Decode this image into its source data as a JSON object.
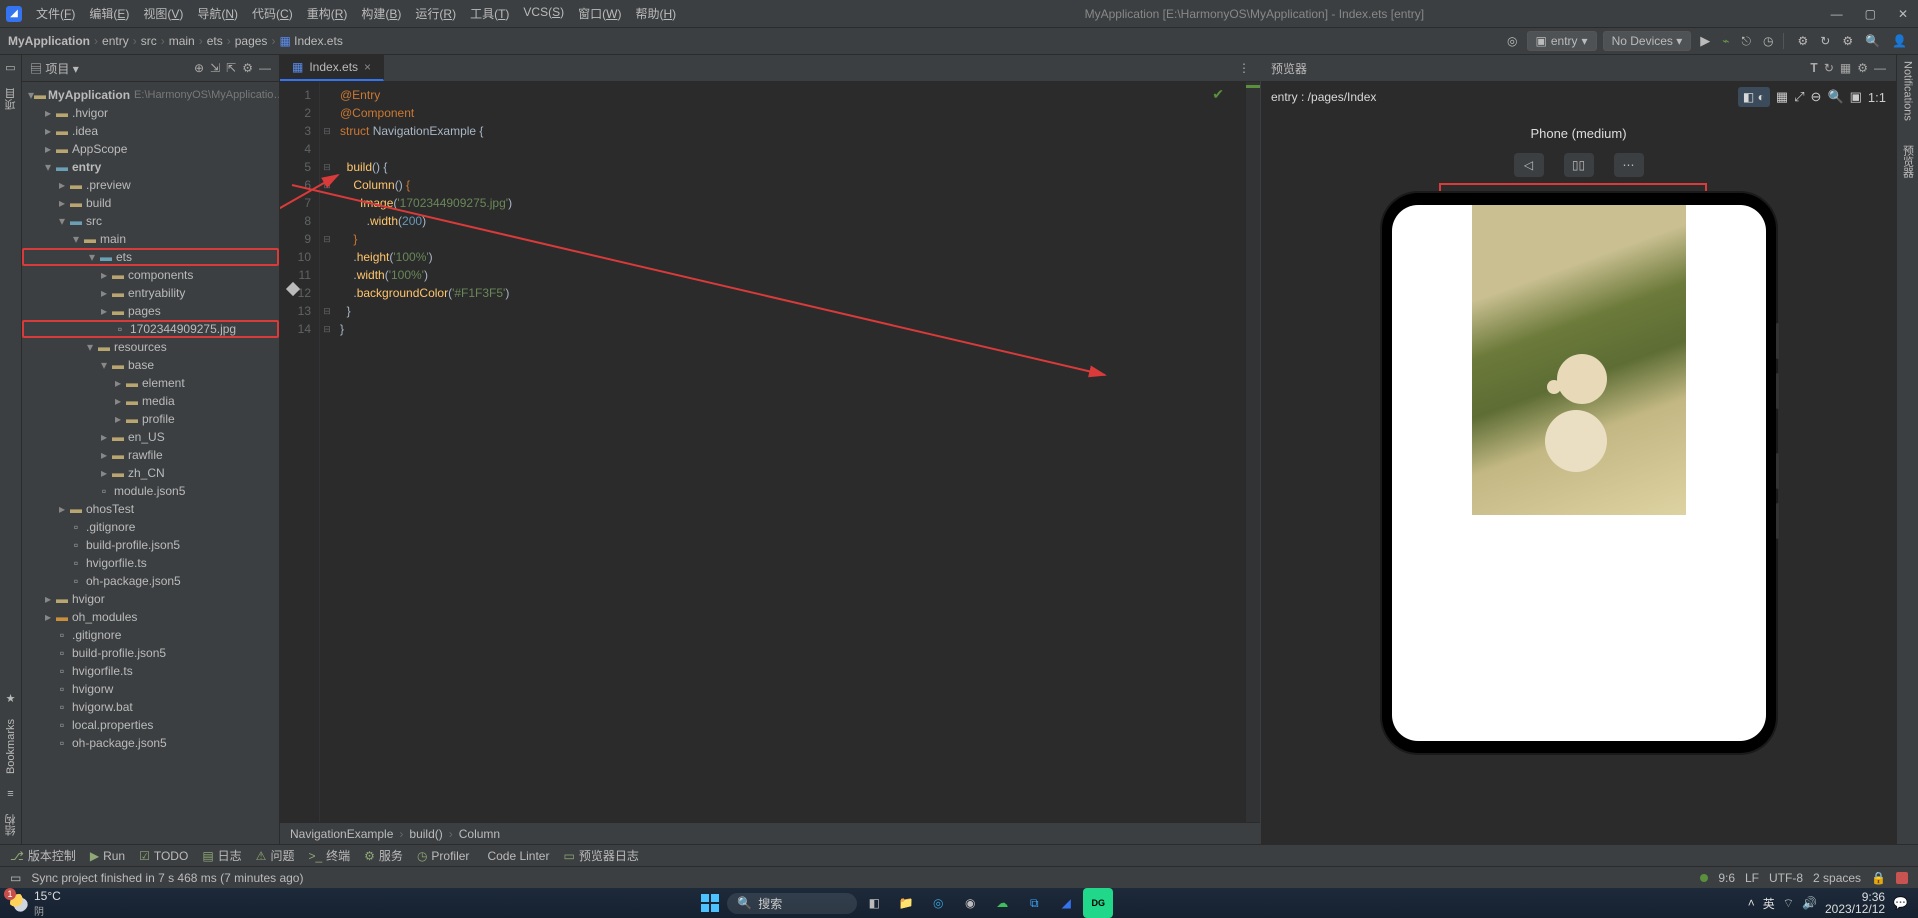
{
  "titlebar": {
    "menus": [
      "文件(F)",
      "编辑(E)",
      "视图(V)",
      "导航(N)",
      "代码(C)",
      "重构(R)",
      "构建(B)",
      "运行(R)",
      "工具(T)",
      "VCS(S)",
      "窗口(W)",
      "帮助(H)"
    ],
    "title": "MyApplication [E:\\HarmonyOS\\MyApplication] - Index.ets [entry]"
  },
  "navbar": {
    "crumbs": [
      "MyApplication",
      "entry",
      "src",
      "main",
      "ets",
      "pages",
      "Index.ets"
    ],
    "entry_pill": "entry",
    "device_pill": "No Devices ▾"
  },
  "project": {
    "title": "项目",
    "rows": [
      {
        "d": 0,
        "arrow": "▾",
        "icon": "folder-ico",
        "label": "MyApplication",
        "extra": "E:\\HarmonyOS\\MyApplicatio…",
        "bold": true
      },
      {
        "d": 1,
        "arrow": "▸",
        "icon": "folder-ico",
        "label": ".hvigor"
      },
      {
        "d": 1,
        "arrow": "▸",
        "icon": "folder-ico",
        "label": ".idea"
      },
      {
        "d": 1,
        "arrow": "▸",
        "icon": "folder-ico",
        "label": "AppScope"
      },
      {
        "d": 1,
        "arrow": "▾",
        "icon": "folder-blue",
        "label": "entry",
        "bold": true
      },
      {
        "d": 2,
        "arrow": "▸",
        "icon": "folder-ico",
        "label": ".preview"
      },
      {
        "d": 2,
        "arrow": "▸",
        "icon": "folder-ico",
        "label": "build"
      },
      {
        "d": 2,
        "arrow": "▾",
        "icon": "folder-blue",
        "label": "src"
      },
      {
        "d": 3,
        "arrow": "▾",
        "icon": "folder-ico",
        "label": "main"
      },
      {
        "d": 4,
        "arrow": "▾",
        "icon": "folder-blue",
        "label": "ets",
        "red": true
      },
      {
        "d": 5,
        "arrow": "▸",
        "icon": "folder-ico",
        "label": "components"
      },
      {
        "d": 5,
        "arrow": "▸",
        "icon": "folder-ico",
        "label": "entryability"
      },
      {
        "d": 5,
        "arrow": "▸",
        "icon": "folder-ico",
        "label": "pages"
      },
      {
        "d": 5,
        "arrow": " ",
        "icon": "file-ico",
        "label": "1702344909275.jpg",
        "red": true
      },
      {
        "d": 4,
        "arrow": "▾",
        "icon": "folder-ico",
        "label": "resources"
      },
      {
        "d": 5,
        "arrow": "▾",
        "icon": "folder-ico",
        "label": "base"
      },
      {
        "d": 6,
        "arrow": "▸",
        "icon": "folder-ico",
        "label": "element"
      },
      {
        "d": 6,
        "arrow": "▸",
        "icon": "folder-ico",
        "label": "media"
      },
      {
        "d": 6,
        "arrow": "▸",
        "icon": "folder-ico",
        "label": "profile"
      },
      {
        "d": 5,
        "arrow": "▸",
        "icon": "folder-ico",
        "label": "en_US"
      },
      {
        "d": 5,
        "arrow": "▸",
        "icon": "folder-ico",
        "label": "rawfile"
      },
      {
        "d": 5,
        "arrow": "▸",
        "icon": "folder-ico",
        "label": "zh_CN"
      },
      {
        "d": 4,
        "arrow": " ",
        "icon": "file-ico",
        "label": "module.json5"
      },
      {
        "d": 2,
        "arrow": "▸",
        "icon": "folder-ico",
        "label": "ohosTest"
      },
      {
        "d": 2,
        "arrow": " ",
        "icon": "file-ico",
        "label": ".gitignore"
      },
      {
        "d": 2,
        "arrow": " ",
        "icon": "file-ico",
        "label": "build-profile.json5"
      },
      {
        "d": 2,
        "arrow": " ",
        "icon": "file-ico",
        "label": "hvigorfile.ts"
      },
      {
        "d": 2,
        "arrow": " ",
        "icon": "file-ico",
        "label": "oh-package.json5"
      },
      {
        "d": 1,
        "arrow": "▸",
        "icon": "folder-ico",
        "label": "hvigor"
      },
      {
        "d": 1,
        "arrow": "▸",
        "icon": "folder-orange",
        "label": "oh_modules"
      },
      {
        "d": 1,
        "arrow": " ",
        "icon": "file-ico",
        "label": ".gitignore"
      },
      {
        "d": 1,
        "arrow": " ",
        "icon": "file-ico",
        "label": "build-profile.json5"
      },
      {
        "d": 1,
        "arrow": " ",
        "icon": "file-ico",
        "label": "hvigorfile.ts"
      },
      {
        "d": 1,
        "arrow": " ",
        "icon": "file-ico",
        "label": "hvigorw"
      },
      {
        "d": 1,
        "arrow": " ",
        "icon": "file-ico",
        "label": "hvigorw.bat"
      },
      {
        "d": 1,
        "arrow": " ",
        "icon": "file-ico",
        "label": "local.properties"
      },
      {
        "d": 1,
        "arrow": " ",
        "icon": "file-ico",
        "label": "oh-package.json5"
      }
    ]
  },
  "editor": {
    "tab_label": "Index.ets",
    "crumbs": [
      "NavigationExample",
      "build()",
      "Column"
    ]
  },
  "previewer": {
    "title": "预览器",
    "path": "entry : /pages/Index",
    "device_label": "Phone (medium)",
    "ratio": "1:1"
  },
  "left_gutter": {
    "project": "项目",
    "bookmarks": "Bookmarks",
    "structure": "结构"
  },
  "right_gutter": {
    "notifications": "Notifications",
    "preview": "预览器"
  },
  "bottombar": {
    "items": [
      "版本控制",
      "Run",
      "TODO",
      "日志",
      "问题",
      "终端",
      "服务",
      "Profiler",
      "Code Linter",
      "预览器日志"
    ]
  },
  "status": {
    "msg": "Sync project finished in 7 s 468 ms (7 minutes ago)",
    "pos": "9:6",
    "lf": "LF",
    "enc": "UTF-8",
    "indent": "2 spaces"
  },
  "taskbar": {
    "temp": "15°C",
    "cond": "阴",
    "search": "搜索",
    "ime": "英",
    "time": "9:36",
    "date": "2023/12/12"
  }
}
